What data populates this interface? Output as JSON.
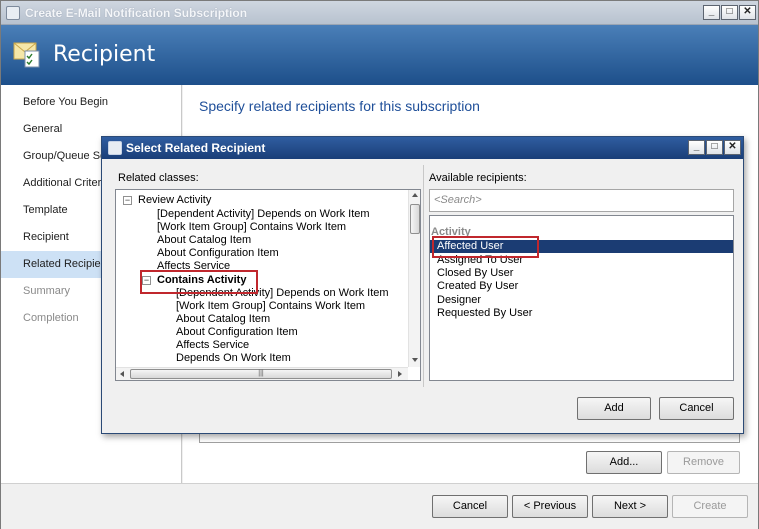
{
  "window": {
    "title": "Create E-Mail Notification Subscription",
    "controls": {
      "minimize": "_",
      "maximize": "□",
      "close": "✕"
    }
  },
  "header": {
    "title": "Recipient",
    "icon": "envelope-checklist-icon"
  },
  "nav": {
    "items": [
      {
        "label": "Before You Begin",
        "state": "normal"
      },
      {
        "label": "General",
        "state": "normal"
      },
      {
        "label": "Group/Queue Se",
        "state": "normal"
      },
      {
        "label": "Additional Criter",
        "state": "normal"
      },
      {
        "label": "Template",
        "state": "normal"
      },
      {
        "label": "Recipient",
        "state": "normal"
      },
      {
        "label": "Related Recipien",
        "state": "selected"
      },
      {
        "label": "Summary",
        "state": "disabled"
      },
      {
        "label": "Completion",
        "state": "disabled"
      }
    ]
  },
  "content": {
    "subtitle": "Specify related recipients for this subscription",
    "add_button": "Add...",
    "remove_button": "Remove"
  },
  "footer": {
    "cancel": "Cancel",
    "previous": "< Previous",
    "next": "Next >",
    "create": "Create"
  },
  "dialog": {
    "title": "Select Related Recipient",
    "controls": {
      "minimize": "_",
      "maximize": "□",
      "close": "✕"
    },
    "related_classes_label": "Related classes:",
    "available_label": "Available recipients:",
    "search_placeholder": "<Search>",
    "tree": [
      {
        "label": "Review Activity",
        "level": 0,
        "expander": "−"
      },
      {
        "label": "[Dependent Activity] Depends on Work Item",
        "level": 1
      },
      {
        "label": "[Work Item Group] Contains Work Item",
        "level": 1
      },
      {
        "label": "About Catalog Item",
        "level": 1
      },
      {
        "label": "About Configuration Item",
        "level": 1
      },
      {
        "label": "Affects Service",
        "level": 1
      },
      {
        "label": "Contains Activity",
        "level": 1,
        "expander": "−",
        "bold": true
      },
      {
        "label": "[Dependent Activity] Depends on Work Item",
        "level": 2
      },
      {
        "label": "[Work Item Group] Contains Work Item",
        "level": 2
      },
      {
        "label": "About Catalog Item",
        "level": 2
      },
      {
        "label": "About Configuration Item",
        "level": 2
      },
      {
        "label": "Affects Service",
        "level": 2
      },
      {
        "label": "Depends On Work Item",
        "level": 2
      }
    ],
    "recipients_group": "Activity",
    "recipients": [
      {
        "label": "Affected User",
        "selected": true
      },
      {
        "label": "Assigned To User",
        "selected": false
      },
      {
        "label": "Closed By User",
        "selected": false
      },
      {
        "label": "Created By User",
        "selected": false
      },
      {
        "label": "Designer",
        "selected": false
      },
      {
        "label": "Requested By User",
        "selected": false
      }
    ],
    "add_button": "Add",
    "cancel_button": "Cancel",
    "hscroll_grip": "|||"
  },
  "colors": {
    "header_blue": "#1d4f8a",
    "dialog_title_blue": "#1a3e78",
    "selection_navy": "#1b3c73",
    "highlight_red": "#c0272d",
    "subtitle_blue": "#1f4f99"
  }
}
